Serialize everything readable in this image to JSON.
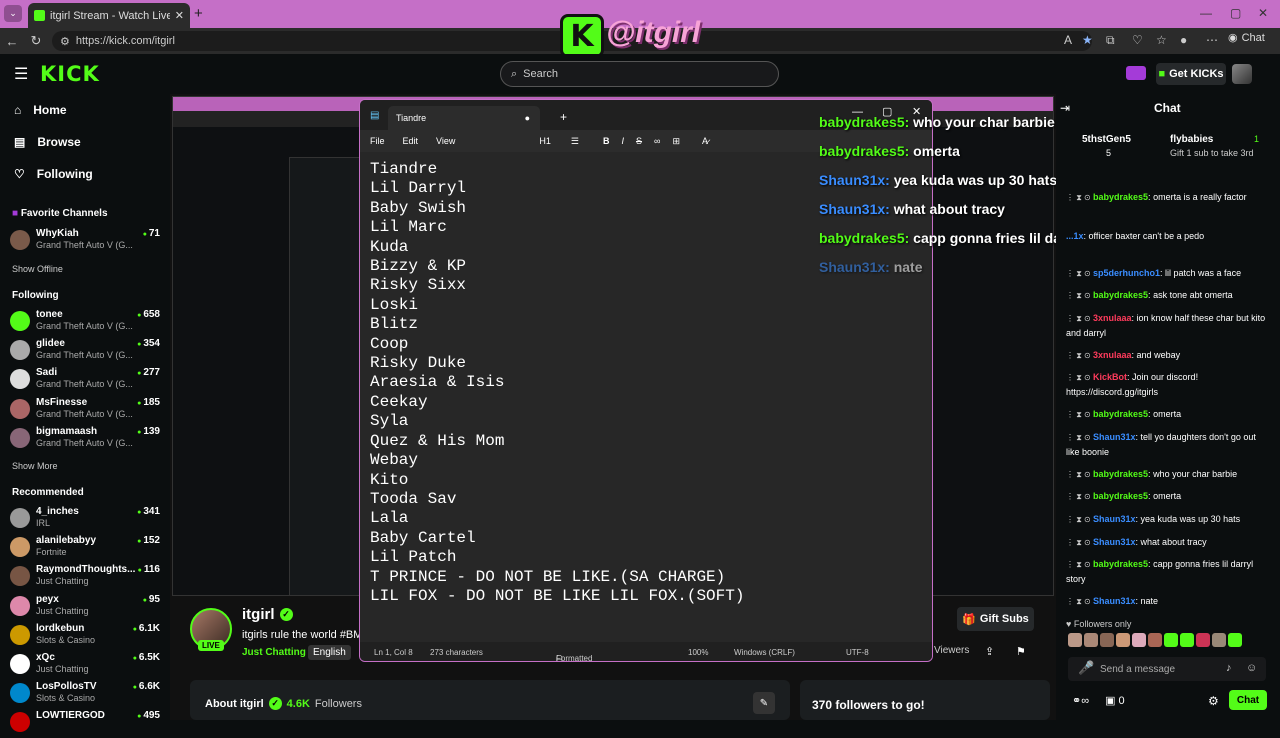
{
  "browser": {
    "tab_title": "itgirl Stream - Watch Live on Kick",
    "url": "https://kick.com/itgirl",
    "chat_label": "Chat",
    "logo_letter": "K",
    "logo_text": "@itgirl"
  },
  "header": {
    "logo": "KICK",
    "search_placeholder": "Search",
    "get_kicks": "Get KICKs"
  },
  "sidebar": {
    "nav": [
      {
        "icon": "home-icon",
        "label": "Home"
      },
      {
        "icon": "browse-icon",
        "label": "Browse"
      },
      {
        "icon": "heart-icon",
        "label": "Following"
      }
    ],
    "favorite_title": "Favorite Channels",
    "favorite": [
      {
        "name": "WhyKiah",
        "game": "Grand Theft Auto V (G...",
        "viewers": "71"
      }
    ],
    "show_offline": "Show Offline",
    "following_title": "Following",
    "following": [
      {
        "name": "tonee",
        "game": "Grand Theft Auto V (G...",
        "viewers": "658"
      },
      {
        "name": "glidee",
        "game": "Grand Theft Auto V (G...",
        "viewers": "354"
      },
      {
        "name": "Sadi",
        "game": "Grand Theft Auto V (G...",
        "viewers": "277"
      },
      {
        "name": "MsFinesse",
        "game": "Grand Theft Auto V (G...",
        "viewers": "185"
      },
      {
        "name": "bigmamaash",
        "game": "Grand Theft Auto V (G...",
        "viewers": "139"
      }
    ],
    "show_more": "Show More",
    "recommended_title": "Recommended",
    "recommended": [
      {
        "name": "4_inches",
        "game": "IRL",
        "viewers": "341"
      },
      {
        "name": "alanilebabyy",
        "game": "Fortnite",
        "viewers": "152"
      },
      {
        "name": "RaymondThoughts...",
        "game": "Just Chatting",
        "viewers": "116"
      },
      {
        "name": "peyx",
        "game": "Just Chatting",
        "viewers": "95"
      },
      {
        "name": "lordkebun",
        "game": "Slots & Casino",
        "viewers": "6.1K"
      },
      {
        "name": "xQc",
        "game": "Just Chatting",
        "viewers": "6.5K"
      },
      {
        "name": "LosPollosTV",
        "game": "Slots & Casino",
        "viewers": "6.6K"
      },
      {
        "name": "LOWTIERGOD",
        "game": "",
        "viewers": "495"
      }
    ]
  },
  "notepad": {
    "tab_title": "Tiandre",
    "menu": [
      "File",
      "Edit",
      "View"
    ],
    "toolbar_heading": "H1",
    "lines": [
      "Tiandre",
      "Lil Darryl",
      "Baby Swish",
      "Lil Marc",
      "Kuda",
      "Bizzy & KP",
      "Risky Sixx",
      "Loski",
      "Blitz",
      "Coop",
      "Risky Duke",
      "Araesia & Isis",
      "Ceekay",
      "Syla",
      "Quez & His Mom",
      "Webay",
      "Kito",
      "Tooda Sav",
      "Lala",
      "Baby Cartel",
      "Lil Patch",
      "T PRINCE - DO NOT BE LIKE.(SA CHARGE)",
      "LIL FOX - DO NOT BE LIKE LIL FOX.(SOFT)"
    ],
    "status": {
      "pos": "Ln 1, Col 8",
      "chars": "273 characters",
      "format": "Formatted",
      "zoom": "100%",
      "eol": "Windows (CRLF)",
      "enc": "UTF-8"
    }
  },
  "overlay_chat": [
    {
      "user": "babydrakes5:",
      "msg": "who your char barbie",
      "color": "#53fc18"
    },
    {
      "user": "babydrakes5:",
      "msg": "omerta",
      "color": "#53fc18"
    },
    {
      "user": "Shaun31x:",
      "msg": "yea kuda was up 30 hats",
      "color": "#3a8dff"
    },
    {
      "user": "Shaun31x:",
      "msg": "what about tracy",
      "color": "#3a8dff"
    },
    {
      "user": "babydrakes5:",
      "msg": "capp gonna fries lil darryl story",
      "color": "#53fc18"
    },
    {
      "user": "Shaun31x:",
      "msg": "nate",
      "color": "#3a8dff"
    }
  ],
  "stream": {
    "name": "itgirl",
    "title": "itgirls rule the world #BM",
    "category": "Just Chatting",
    "language": "English",
    "live": "LIVE",
    "gift_subs": "Gift Subs",
    "viewers_label": "Viewers",
    "about": "About itgirl",
    "followers": "4.6K",
    "followers_label": "Followers",
    "goal": "370 followers to go!"
  },
  "chat": {
    "title": "Chat",
    "pinned": {
      "user1": "5thstGen5",
      "count1": "5",
      "user2": "flybabies",
      "count2": "1",
      "sub": "Gift 1 sub to take 3rd"
    },
    "messages": [
      {
        "user": "",
        "msg": "factor",
        "color": "#fff"
      },
      {
        "user": "babydrakes5",
        "msg": "omerta is a really factor",
        "color": "#53fc18"
      },
      {
        "user": "...1x",
        "msg": "officer baxter can't be a pedo",
        "color": "#3a8dff"
      },
      {
        "user": "sp5derhuncho1",
        "msg": "lil patch was a face",
        "color": "#3a8dff"
      },
      {
        "user": "babydrakes5",
        "msg": "ask tone abt omerta",
        "color": "#53fc18"
      },
      {
        "user": "3xnulaaa",
        "msg": "ion know half these char but kito and darryl",
        "color": "#ff3b5c"
      },
      {
        "user": "3xnulaaa",
        "msg": "and webay",
        "color": "#ff3b5c"
      },
      {
        "user": "KickBot",
        "msg": "Join our discord! https://discord.gg/itgirls",
        "color": "#ff3b5c"
      },
      {
        "user": "babydrakes5",
        "msg": "omerta",
        "color": "#53fc18"
      },
      {
        "user": "Shaun31x",
        "msg": "tell yo daughters don't go out like boonie",
        "color": "#3a8dff"
      },
      {
        "user": "babydrakes5",
        "msg": "who your char barbie",
        "color": "#53fc18"
      },
      {
        "user": "babydrakes5",
        "msg": "omerta",
        "color": "#53fc18"
      },
      {
        "user": "Shaun31x",
        "msg": "yea kuda was up 30 hats",
        "color": "#3a8dff"
      },
      {
        "user": "Shaun31x",
        "msg": "what about tracy",
        "color": "#3a8dff"
      },
      {
        "user": "babydrakes5",
        "msg": "capp gonna fries lil darryl story",
        "color": "#53fc18"
      },
      {
        "user": "Shaun31x",
        "msg": "nate",
        "color": "#3a8dff"
      }
    ],
    "followers_only": "Followers only",
    "send_placeholder": "Send a message",
    "points": "0",
    "send_button": "Chat"
  },
  "colors": {
    "accent": "#53fc18",
    "tab_bar": "#c56fc7"
  }
}
